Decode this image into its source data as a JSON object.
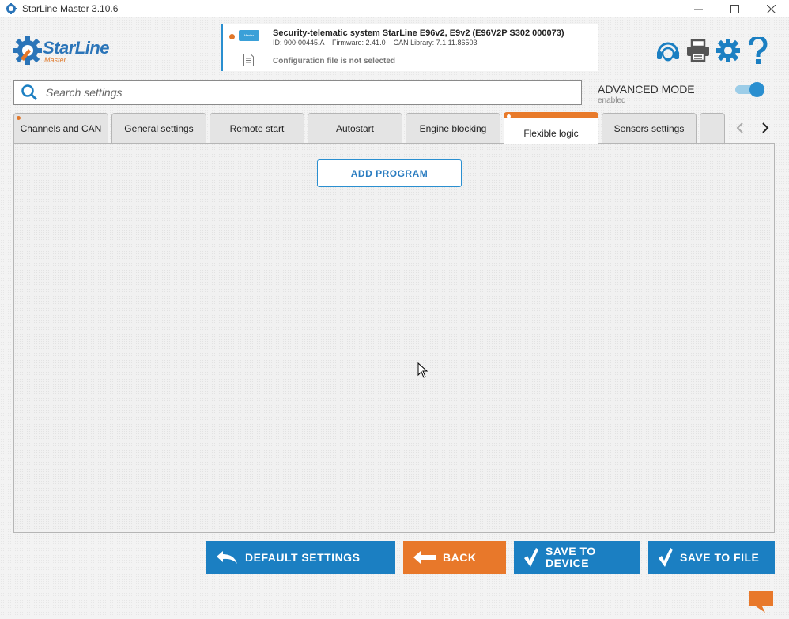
{
  "window": {
    "title": "StarLine Master 3.10.6"
  },
  "header": {
    "brand": "StarLine",
    "brand_sub": "Master",
    "device_title": "Security-telematic system StarLine E96v2, E9v2 (E96V2P S302 000073)",
    "device_meta": "ID: 900-00445.A    Firmware: 2.41.0    CAN Library: 7.1.11.86503",
    "device_thumb_label": "Master",
    "config_status": "Configuration file is not selected",
    "icons": [
      "support-icon",
      "print-icon",
      "gear-icon",
      "help-icon"
    ]
  },
  "search": {
    "placeholder": "Search settings",
    "value": ""
  },
  "advanced_mode": {
    "label": "ADVANCED MODE",
    "status": "enabled",
    "on": true
  },
  "tabs": [
    {
      "label": "Channels and CAN",
      "active": false,
      "dot": true
    },
    {
      "label": "General settings",
      "active": false,
      "dot": false
    },
    {
      "label": "Remote start",
      "active": false,
      "dot": false
    },
    {
      "label": "Autostart",
      "active": false,
      "dot": false
    },
    {
      "label": "Engine blocking",
      "active": false,
      "dot": false
    },
    {
      "label": "Flexible logic",
      "active": true,
      "dot": true
    },
    {
      "label": "Sensors settings",
      "active": false,
      "dot": false
    },
    {
      "label": "",
      "active": false,
      "dot": false
    }
  ],
  "content": {
    "add_program_label": "ADD PROGRAM"
  },
  "footer": {
    "default_settings": "DEFAULT SETTINGS",
    "back": "BACK",
    "save_to_device_1": "SAVE TO",
    "save_to_device_2": "DEVICE",
    "save_to_file": "SAVE TO FILE"
  },
  "colors": {
    "accent_blue": "#1b7fc2",
    "accent_orange": "#e8782a"
  }
}
